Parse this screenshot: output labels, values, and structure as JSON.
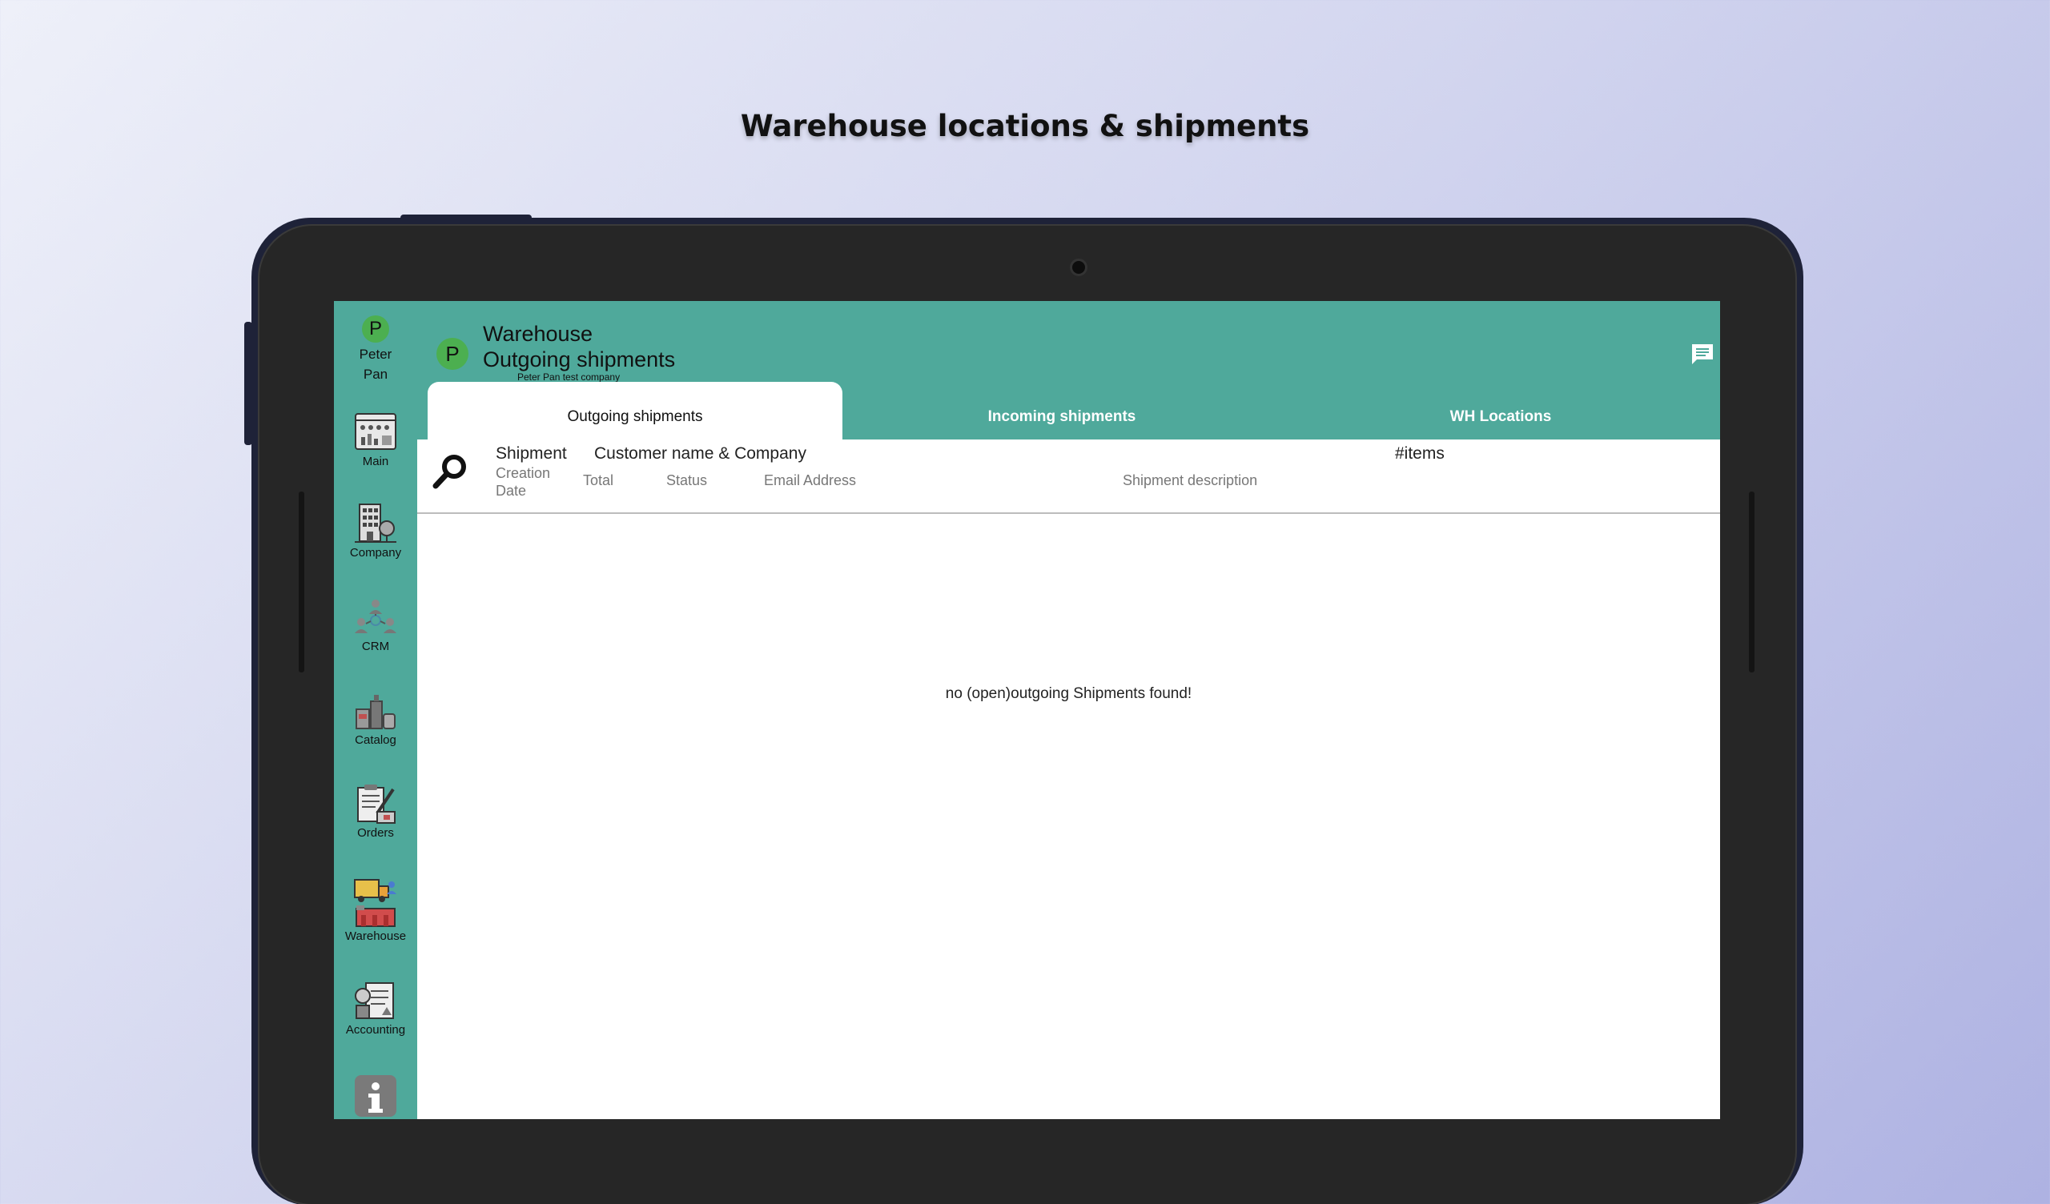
{
  "headline": "Warehouse locations & shipments",
  "sidebar": {
    "user": {
      "initial": "P",
      "name_line1": "Peter",
      "name_line2": "Pan"
    },
    "items": [
      {
        "label": "Main",
        "icon": "dashboard-icon"
      },
      {
        "label": "Company",
        "icon": "building-icon"
      },
      {
        "label": "CRM",
        "icon": "people-network-icon"
      },
      {
        "label": "Catalog",
        "icon": "products-icon"
      },
      {
        "label": "Orders",
        "icon": "order-form-icon"
      },
      {
        "label": "Warehouse",
        "icon": "warehouse-truck-icon"
      },
      {
        "label": "Accounting",
        "icon": "accounting-icon"
      }
    ],
    "info_icon": "info-icon"
  },
  "header": {
    "avatar_initial": "P",
    "title": "Warehouse",
    "subtitle": "Outgoing shipments",
    "company": "Peter Pan test company",
    "chat_icon": "chat-icon"
  },
  "tabs": [
    {
      "label": "Outgoing shipments",
      "active": true
    },
    {
      "label": "Incoming shipments",
      "active": false
    },
    {
      "label": "WH Locations",
      "active": false
    }
  ],
  "columns": {
    "shipment": "Shipment",
    "creation_date_line1": "Creation",
    "creation_date_line2": "Date",
    "customer": "Customer name & Company",
    "total": "Total",
    "status": "Status",
    "email": "Email Address",
    "description": "Shipment description",
    "items": "#items"
  },
  "empty_message": "no (open)outgoing Shipments found!",
  "colors": {
    "accent": "#4fa99b",
    "avatar": "#4caf50"
  }
}
